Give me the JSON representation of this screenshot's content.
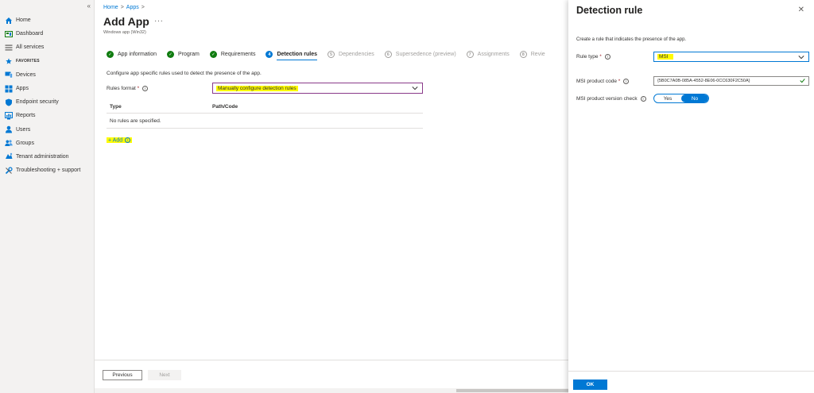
{
  "nav": {
    "collapse_glyph": "«",
    "items": [
      {
        "label": "Home",
        "icon": "home-icon",
        "color": "#0078d4"
      },
      {
        "label": "Dashboard",
        "icon": "dashboard-icon",
        "color": "#107c10"
      },
      {
        "label": "All services",
        "icon": "list-icon",
        "color": "#605e5c"
      },
      {
        "label": "FAVORITES",
        "icon": "star-icon",
        "color": "#0078d4"
      },
      {
        "label": "Devices",
        "icon": "devices-icon",
        "color": "#0078d4"
      },
      {
        "label": "Apps",
        "icon": "apps-icon",
        "color": "#0078d4"
      },
      {
        "label": "Endpoint security",
        "icon": "shield-icon",
        "color": "#0078d4"
      },
      {
        "label": "Reports",
        "icon": "reports-icon",
        "color": "#0078d4"
      },
      {
        "label": "Users",
        "icon": "user-icon",
        "color": "#0078d4"
      },
      {
        "label": "Groups",
        "icon": "groups-icon",
        "color": "#0078d4"
      },
      {
        "label": "Tenant administration",
        "icon": "tenant-icon",
        "color": "#0078d4"
      },
      {
        "label": "Troubleshooting + support",
        "icon": "tools-icon",
        "color": "#0078d4"
      }
    ]
  },
  "breadcrumb": {
    "home": "Home",
    "apps": "Apps",
    "sep": ">"
  },
  "page": {
    "title": "Add App",
    "more": "···",
    "subtitle": "Windows app (Win32)"
  },
  "wizard": {
    "steps": [
      {
        "label": "App information",
        "status": "done",
        "marker": "✓"
      },
      {
        "label": "Program",
        "status": "done",
        "marker": "✓"
      },
      {
        "label": "Requirements",
        "status": "done",
        "marker": "✓"
      },
      {
        "label": "Detection rules",
        "status": "current",
        "marker": "4"
      },
      {
        "label": "Dependencies",
        "status": "todo",
        "marker": "5"
      },
      {
        "label": "Supersedence (preview)",
        "status": "todo",
        "marker": "6"
      },
      {
        "label": "Assignments",
        "status": "todo",
        "marker": "7"
      },
      {
        "label": "Revie",
        "status": "todo",
        "marker": "8"
      }
    ]
  },
  "main": {
    "helper": "Configure app specific rules used to detect the presence of the app.",
    "rules_format_label": "Rules format",
    "required_mark": "*",
    "info_glyph": "i",
    "rules_format_value": "Manually configure detection rules",
    "table": {
      "col_type": "Type",
      "col_path": "Path/Code",
      "empty": "No rules are specified."
    },
    "add_label": "+ Add"
  },
  "footer": {
    "previous": "Previous",
    "next": "Next"
  },
  "panel": {
    "title": "Detection rule",
    "close_glyph": "✕",
    "description": "Create a rule that indicates the presence of the app.",
    "rule_type_label": "Rule type",
    "rule_type_value": "MSI",
    "product_code_label": "MSI product code",
    "product_code_value": "{5B0C7A0B-085A-4552-8E06-0CC630F2C50A}",
    "version_check_label": "MSI product version check",
    "toggle_yes": "Yes",
    "toggle_no": "No",
    "toggle_selected": "No",
    "ok": "OK"
  },
  "colors": {
    "accent": "#0078d4",
    "success": "#107c10",
    "highlight": "#fffb00"
  }
}
